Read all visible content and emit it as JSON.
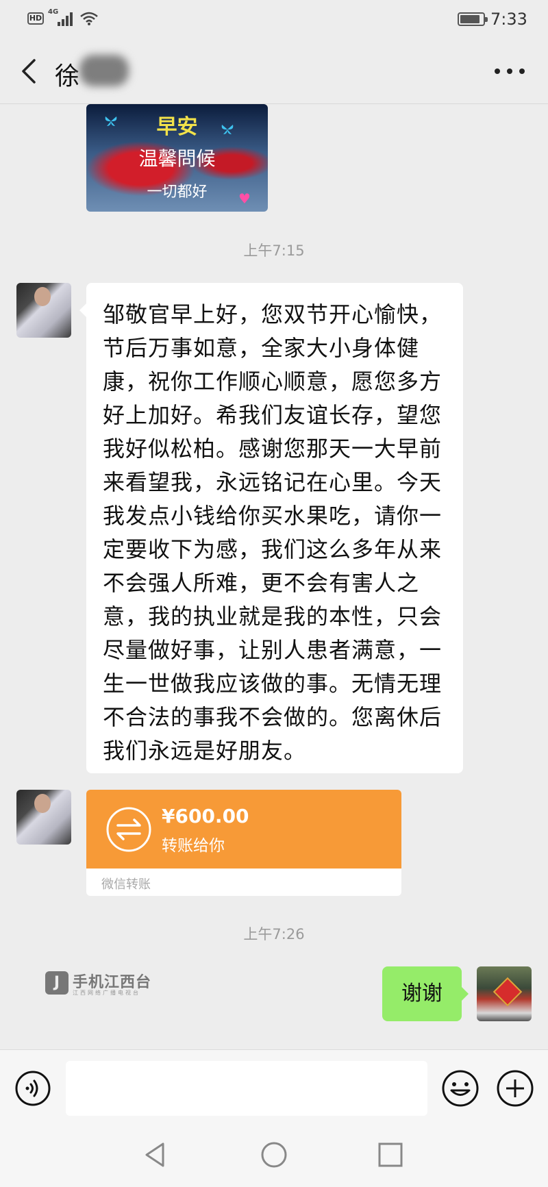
{
  "status_bar": {
    "hd_label": "HD",
    "network_label": "4G",
    "time": "7:33",
    "icons": [
      "signal-icon",
      "wifi-icon",
      "battery-icon"
    ]
  },
  "header": {
    "contact_name": "徐",
    "icons": [
      "back-icon",
      "more-icon"
    ]
  },
  "greeting_image": {
    "title": "早安",
    "subtitle": "温馨問候",
    "line": "一切都好"
  },
  "messages": {
    "timestamp_1": "上午7:15",
    "text_message": "邹敬官早上好，您双节开心愉快，节后万事如意，全家大小身体健康，祝你工作顺心顺意，愿您多方好上加好。希我们友谊长存，望您我好似松柏。感谢您那天一大早前来看望我，永远铭记在心里。今天我发点小钱给你买水果吃，请你一定要收下为感，我们这么多年从来不会强人所难，更不会有害人之意，我的执业就是我的本性，只会尽量做好事，让别人患者满意，一生一世做我应该做的事。无情无理不合法的事我不会做的。您离休后我们永远是好朋友。",
    "transfer": {
      "amount": "¥600.00",
      "label": "转账给你",
      "footer": "微信转账"
    },
    "timestamp_2": "上午7:26",
    "reply": "谢谢"
  },
  "watermark": {
    "logo_char": "J",
    "text": "手机江西台",
    "subtext": "江西网络广播电视台"
  },
  "input_bar": {
    "placeholder": "",
    "icons": [
      "voice-icon",
      "emoji-icon",
      "plus-icon"
    ]
  },
  "nav_bar": {
    "icons": [
      "nav-back-icon",
      "nav-home-icon",
      "nav-recents-icon"
    ]
  },
  "colors": {
    "background": "#ededed",
    "transfer_orange": "#f79a37",
    "reply_green": "#95ec69"
  }
}
